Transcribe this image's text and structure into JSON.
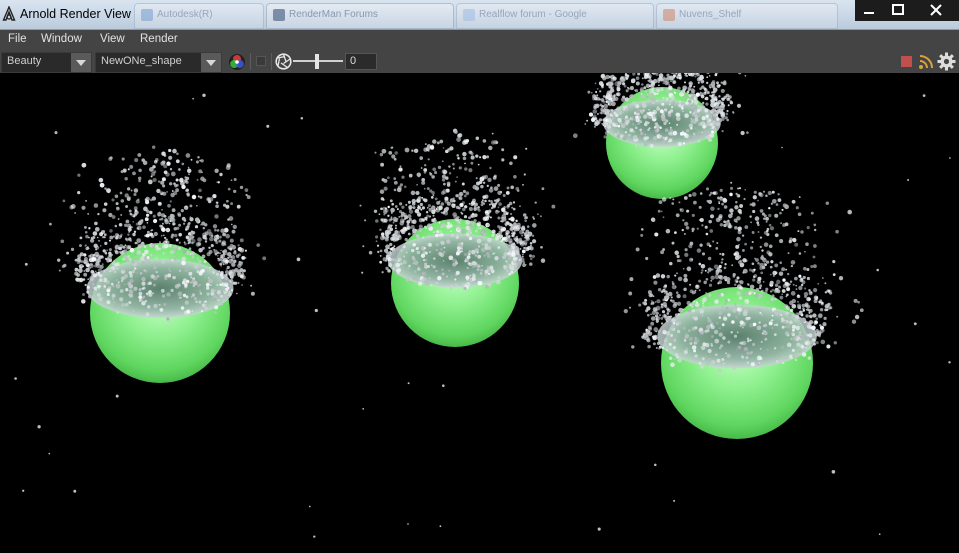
{
  "window": {
    "title": "Arnold Render View",
    "background_tabs": [
      "Autodesk(R)",
      "RenderMan Forums",
      "Realflow forum - Google",
      "Nuvens_Shelf"
    ],
    "minimize_glyph": "–",
    "maximize_glyph": "□",
    "close_glyph": "✕"
  },
  "menu": {
    "items": [
      "File",
      "Window",
      "View",
      "Render"
    ]
  },
  "toolbar": {
    "aov_value": "Beauty",
    "camera_value": "NewONe_shape",
    "exposure_value": "0",
    "icons": [
      "color-wheel-icon",
      "checkbox-icon",
      "aperture-icon",
      "stop-render-icon",
      "ipr-refresh-icon",
      "settings-gear-icon"
    ]
  },
  "colors": {
    "menu_bg": "#444444",
    "viewport_bg": "#000000",
    "splash_green": "#8cf58c",
    "stop_red": "#c0504d",
    "ipr_orange": "#d9a23a"
  }
}
